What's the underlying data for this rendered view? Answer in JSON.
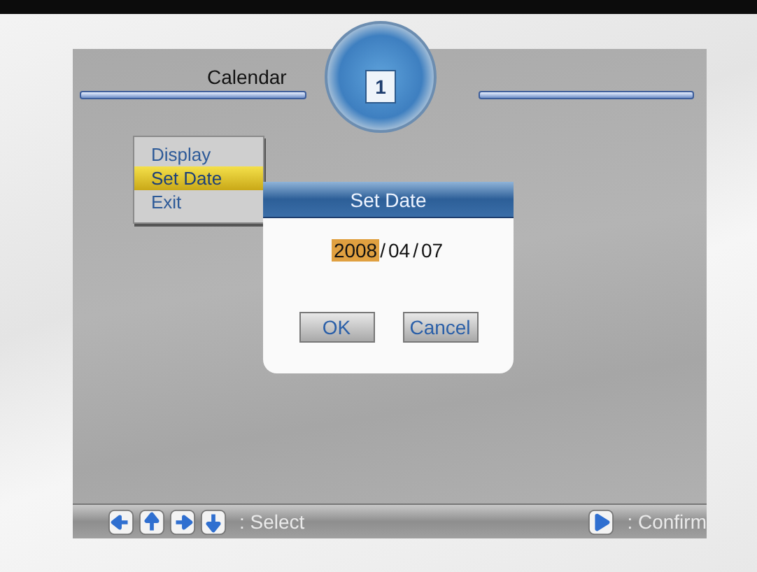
{
  "header": {
    "title": "Calendar",
    "emblem_text": "1"
  },
  "menu": {
    "items": [
      {
        "label": "Display",
        "selected": false
      },
      {
        "label": "Set Date",
        "selected": true
      },
      {
        "label": "Exit",
        "selected": false
      }
    ]
  },
  "dialog": {
    "title": "Set Date",
    "date_parts": [
      {
        "text": "2008",
        "selected": true
      },
      {
        "text": "/",
        "selected": false
      },
      {
        "text": "04",
        "selected": false
      },
      {
        "text": "/",
        "selected": false
      },
      {
        "text": "07",
        "selected": false
      }
    ],
    "buttons": [
      "OK",
      "Cancel"
    ]
  },
  "footer": {
    "hints": [
      {
        "keys": [
          {
            "kind": "left"
          },
          {
            "kind": "up"
          },
          {
            "kind": "right"
          },
          {
            "kind": "down"
          }
        ],
        "label": ": Select"
      },
      {
        "keys": [
          {
            "kind": "play"
          }
        ],
        "label": ": Confirm"
      }
    ]
  }
}
